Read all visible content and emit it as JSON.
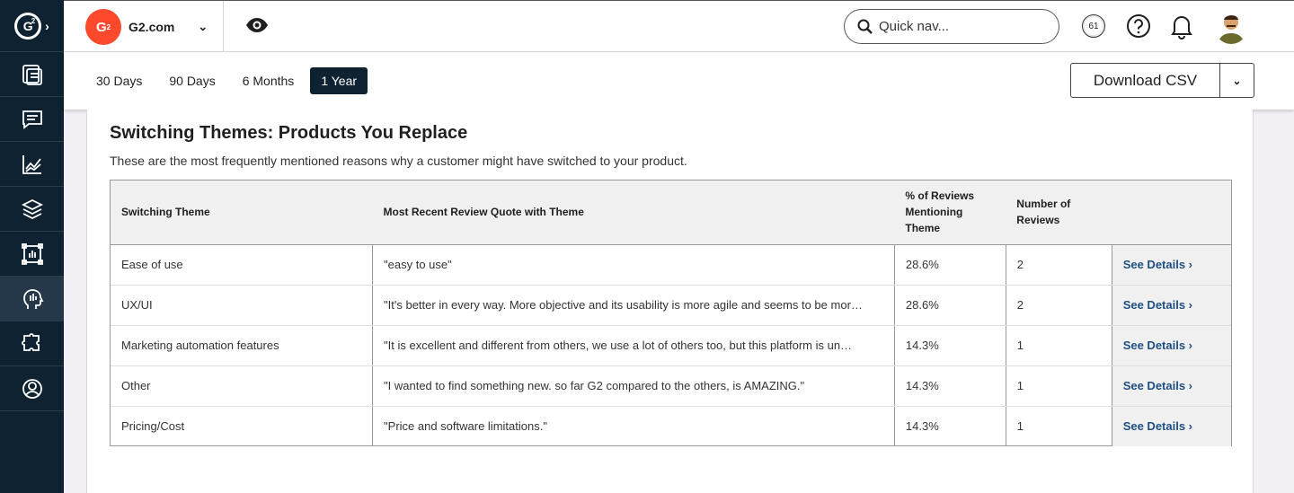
{
  "rail": {
    "logo_text": "2",
    "items": [
      "dashboard",
      "reviews",
      "analytics",
      "integrations",
      "reports",
      "buyer-intent",
      "partners",
      "profile"
    ]
  },
  "topbar": {
    "brand_initials": "2",
    "brand_name": "G2.com",
    "search_placeholder": "Quick nav...",
    "notification_count": "61"
  },
  "filters": {
    "tabs": [
      {
        "label": "30 Days",
        "active": false
      },
      {
        "label": "90 Days",
        "active": false
      },
      {
        "label": "6 Months",
        "active": false
      },
      {
        "label": "1 Year",
        "active": true
      }
    ],
    "download_label": "Download CSV"
  },
  "section": {
    "title": "Switching Themes: Products You Replace",
    "subtitle": "These are the most frequently mentioned reasons why a customer might have switched to your product."
  },
  "table": {
    "headers": {
      "theme": "Switching Theme",
      "quote": "Most Recent Review Quote with Theme",
      "percent": "% of Reviews Mentioning Theme",
      "count": "Number of Reviews"
    },
    "details_label": "See Details ›",
    "rows": [
      {
        "theme": "Ease of use",
        "quote": "\"easy to use\"",
        "percent": "28.6%",
        "count": "2"
      },
      {
        "theme": "UX/UI",
        "quote": "\"It's better in every way. More objective and its usability is more agile and seems to be mor…",
        "percent": "28.6%",
        "count": "2"
      },
      {
        "theme": "Marketing automation features",
        "quote": "\"It is excellent and different from others, we use a lot of others too, but this platform is un…",
        "percent": "14.3%",
        "count": "1"
      },
      {
        "theme": "Other",
        "quote": "\"I wanted to find something new. so far G2 compared to the others, is AMAZING.\"",
        "percent": "14.3%",
        "count": "1"
      },
      {
        "theme": "Pricing/Cost",
        "quote": "\"Price and software limitations.\"",
        "percent": "14.3%",
        "count": "1"
      }
    ]
  },
  "colors": {
    "rail_bg": "#0e2231",
    "brand_red": "#ff492c",
    "link_blue": "#1f4f82"
  }
}
